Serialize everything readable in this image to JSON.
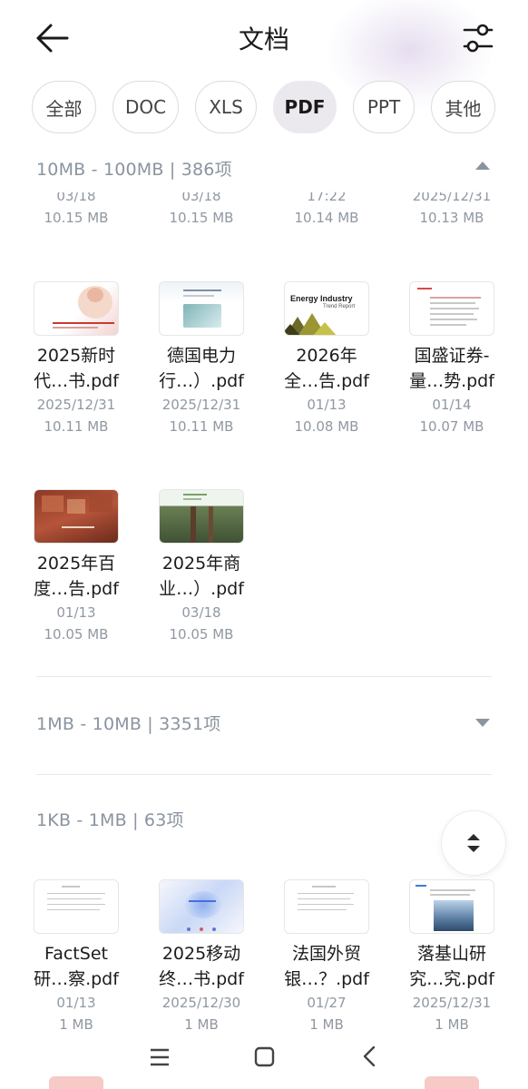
{
  "header": {
    "title": "文档"
  },
  "tabs": [
    {
      "label": "全部",
      "active": false
    },
    {
      "label": "DOC",
      "active": false
    },
    {
      "label": "XLS",
      "active": false
    },
    {
      "label": "PDF",
      "active": true
    },
    {
      "label": "PPT",
      "active": false
    },
    {
      "label": "其他",
      "active": false
    }
  ],
  "section_large": {
    "title": "10MB - 100MB  |  386项",
    "expanded": true
  },
  "partial_row": [
    {
      "date": "03/18",
      "size": "10.15 MB"
    },
    {
      "date": "03/18",
      "size": "10.15 MB"
    },
    {
      "date": "17:22",
      "size": "10.14 MB"
    },
    {
      "date": "2025/12/31",
      "size": "10.13 MB"
    }
  ],
  "row2": [
    {
      "name1": "2025新时",
      "name2": "代…书.pdf",
      "date": "2025/12/31",
      "size": "10.11 MB",
      "thumb": "red-report"
    },
    {
      "name1": "德国电力",
      "name2": "行…）.pdf",
      "date": "2025/12/31",
      "size": "10.11 MB",
      "thumb": "blue-report"
    },
    {
      "name1": "2026年",
      "name2": "全…告.pdf",
      "date": "01/13",
      "size": "10.08 MB",
      "thumb": "energy-report",
      "thumb_title": "Energy Industry",
      "thumb_sub": "Trend Report"
    },
    {
      "name1": "国盛证券-",
      "name2": "量…势.pdf",
      "date": "01/14",
      "size": "10.07 MB",
      "thumb": "text-doc"
    }
  ],
  "row3": [
    {
      "name1": "2025年百",
      "name2": "度…告.pdf",
      "date": "01/13",
      "size": "10.05 MB",
      "thumb": "book-cover"
    },
    {
      "name1": "2025年商",
      "name2": "业…）.pdf",
      "date": "03/18",
      "size": "10.05 MB",
      "thumb": "forest-cover"
    }
  ],
  "section_medium": {
    "title": "1MB - 10MB  |  3351项",
    "expanded": false
  },
  "section_small": {
    "title": "1KB -  1MB  |  63项"
  },
  "row_small": [
    {
      "name1": "FactSet",
      "name2": "研…察.pdf",
      "date": "01/13",
      "size": "1 MB",
      "thumb": "text-doc"
    },
    {
      "name1": "2025移动",
      "name2": "终…书.pdf",
      "date": "2025/12/30",
      "size": "1 MB",
      "thumb": "blue-glow"
    },
    {
      "name1": "法国外贸",
      "name2": "银…？.pdf",
      "date": "01/27",
      "size": "1 MB",
      "thumb": "text-doc"
    },
    {
      "name1": "落基山研",
      "name2": "究…究.pdf",
      "date": "2025/12/31",
      "size": "1 MB",
      "thumb": "building"
    }
  ],
  "colors": {
    "accent_bg": "#ece9ee",
    "muted_text": "#8a94a0"
  }
}
